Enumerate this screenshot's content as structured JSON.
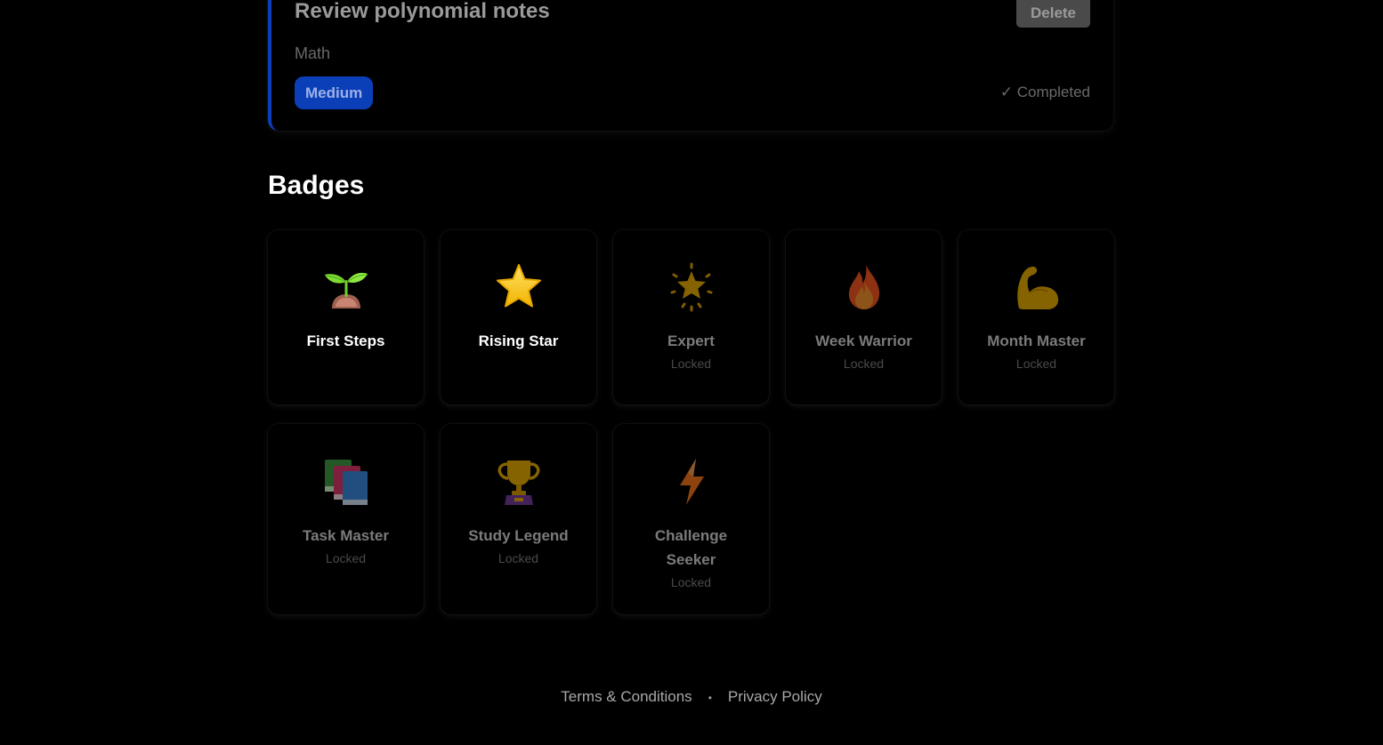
{
  "task": {
    "title": "Review polynomial notes",
    "delete_label": "Delete",
    "subject": "Math",
    "priority": "Medium",
    "status": "✓ Completed"
  },
  "badges_section": {
    "title": "Badges",
    "locked_label": "Locked",
    "items": [
      {
        "name": "First Steps",
        "icon": "seedling-icon",
        "locked": false
      },
      {
        "name": "Rising Star",
        "icon": "star-icon",
        "locked": false
      },
      {
        "name": "Expert",
        "icon": "glowing-star-icon",
        "locked": true
      },
      {
        "name": "Week Warrior",
        "icon": "fire-icon",
        "locked": true
      },
      {
        "name": "Month Master",
        "icon": "flexed-bicep-icon",
        "locked": true
      },
      {
        "name": "Task Master",
        "icon": "books-icon",
        "locked": true
      },
      {
        "name": "Study Legend",
        "icon": "trophy-icon",
        "locked": true
      },
      {
        "name": "Challenge Seeker",
        "icon": "lightning-icon",
        "locked": true
      }
    ]
  },
  "footer": {
    "terms": "Terms & Conditions",
    "separator": "•",
    "privacy": "Privacy Policy"
  },
  "colors": {
    "background": "#000000",
    "priority_medium": "#0b3fb8",
    "task_accent": "#0b3fb8",
    "delete_button": "#4a4a4a"
  }
}
